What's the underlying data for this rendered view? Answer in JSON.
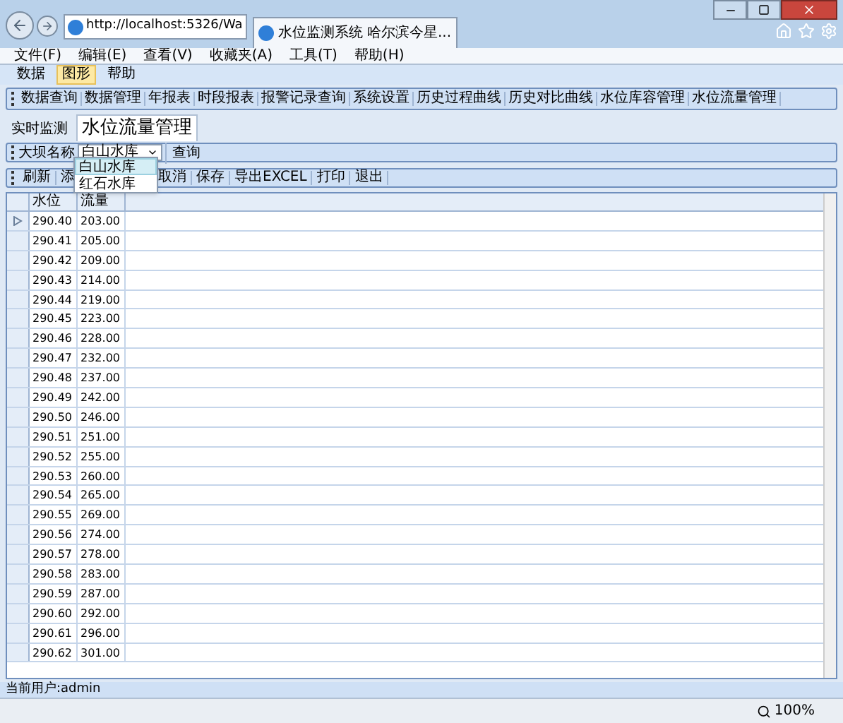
{
  "browser": {
    "address": "http://localhost:5326/Wa",
    "tab_title": "水位监测系统 哈尔滨今星...",
    "menu": [
      "文件(F)",
      "编辑(E)",
      "查看(V)",
      "收藏夹(A)",
      "工具(T)",
      "帮助(H)"
    ]
  },
  "app_menu": [
    {
      "label": "数据",
      "selected": false
    },
    {
      "label": "图形",
      "selected": true
    },
    {
      "label": "帮助",
      "selected": false
    }
  ],
  "nav_toolbar": [
    "数据查询",
    "数据管理",
    "年报表",
    "时段报表",
    "报警记录查询",
    "系统设置",
    "历史过程曲线",
    "历史对比曲线",
    "水位库容管理",
    "水位流量管理"
  ],
  "tabs": [
    {
      "label": "实时监测",
      "selected": false
    },
    {
      "label": "水位流量管理",
      "selected": true
    }
  ],
  "query_bar": {
    "label": "大坝名称",
    "value": "白山水库",
    "button": "查询",
    "dropdown": [
      {
        "label": "白山水库",
        "selected": true
      },
      {
        "label": "红石水库",
        "selected": false
      }
    ]
  },
  "actions": [
    "刷新",
    "添",
    "取消",
    "保存",
    "导出EXCEL",
    "打印",
    "退出"
  ],
  "table": {
    "columns": [
      "水位",
      "流量"
    ],
    "rows": [
      {
        "cells": [
          "290.40",
          "203.00"
        ],
        "selected": true
      },
      {
        "cells": [
          "290.41",
          "205.00"
        ],
        "selected": false
      },
      {
        "cells": [
          "290.42",
          "209.00"
        ],
        "selected": false
      },
      {
        "cells": [
          "290.43",
          "214.00"
        ],
        "selected": false
      },
      {
        "cells": [
          "290.44",
          "219.00"
        ],
        "selected": false
      },
      {
        "cells": [
          "290.45",
          "223.00"
        ],
        "selected": false
      },
      {
        "cells": [
          "290.46",
          "228.00"
        ],
        "selected": false
      },
      {
        "cells": [
          "290.47",
          "232.00"
        ],
        "selected": false
      },
      {
        "cells": [
          "290.48",
          "237.00"
        ],
        "selected": false
      },
      {
        "cells": [
          "290.49",
          "242.00"
        ],
        "selected": false
      },
      {
        "cells": [
          "290.50",
          "246.00"
        ],
        "selected": false
      },
      {
        "cells": [
          "290.51",
          "251.00"
        ],
        "selected": false
      },
      {
        "cells": [
          "290.52",
          "255.00"
        ],
        "selected": false
      },
      {
        "cells": [
          "290.53",
          "260.00"
        ],
        "selected": false
      },
      {
        "cells": [
          "290.54",
          "265.00"
        ],
        "selected": false
      },
      {
        "cells": [
          "290.55",
          "269.00"
        ],
        "selected": false
      },
      {
        "cells": [
          "290.56",
          "274.00"
        ],
        "selected": false
      },
      {
        "cells": [
          "290.57",
          "278.00"
        ],
        "selected": false
      },
      {
        "cells": [
          "290.58",
          "283.00"
        ],
        "selected": false
      },
      {
        "cells": [
          "290.59",
          "287.00"
        ],
        "selected": false
      },
      {
        "cells": [
          "290.60",
          "292.00"
        ],
        "selected": false
      },
      {
        "cells": [
          "290.61",
          "296.00"
        ],
        "selected": false
      },
      {
        "cells": [
          "290.62",
          "301.00"
        ],
        "selected": false
      }
    ]
  },
  "status": "当前用户:admin",
  "zoom": "100%"
}
